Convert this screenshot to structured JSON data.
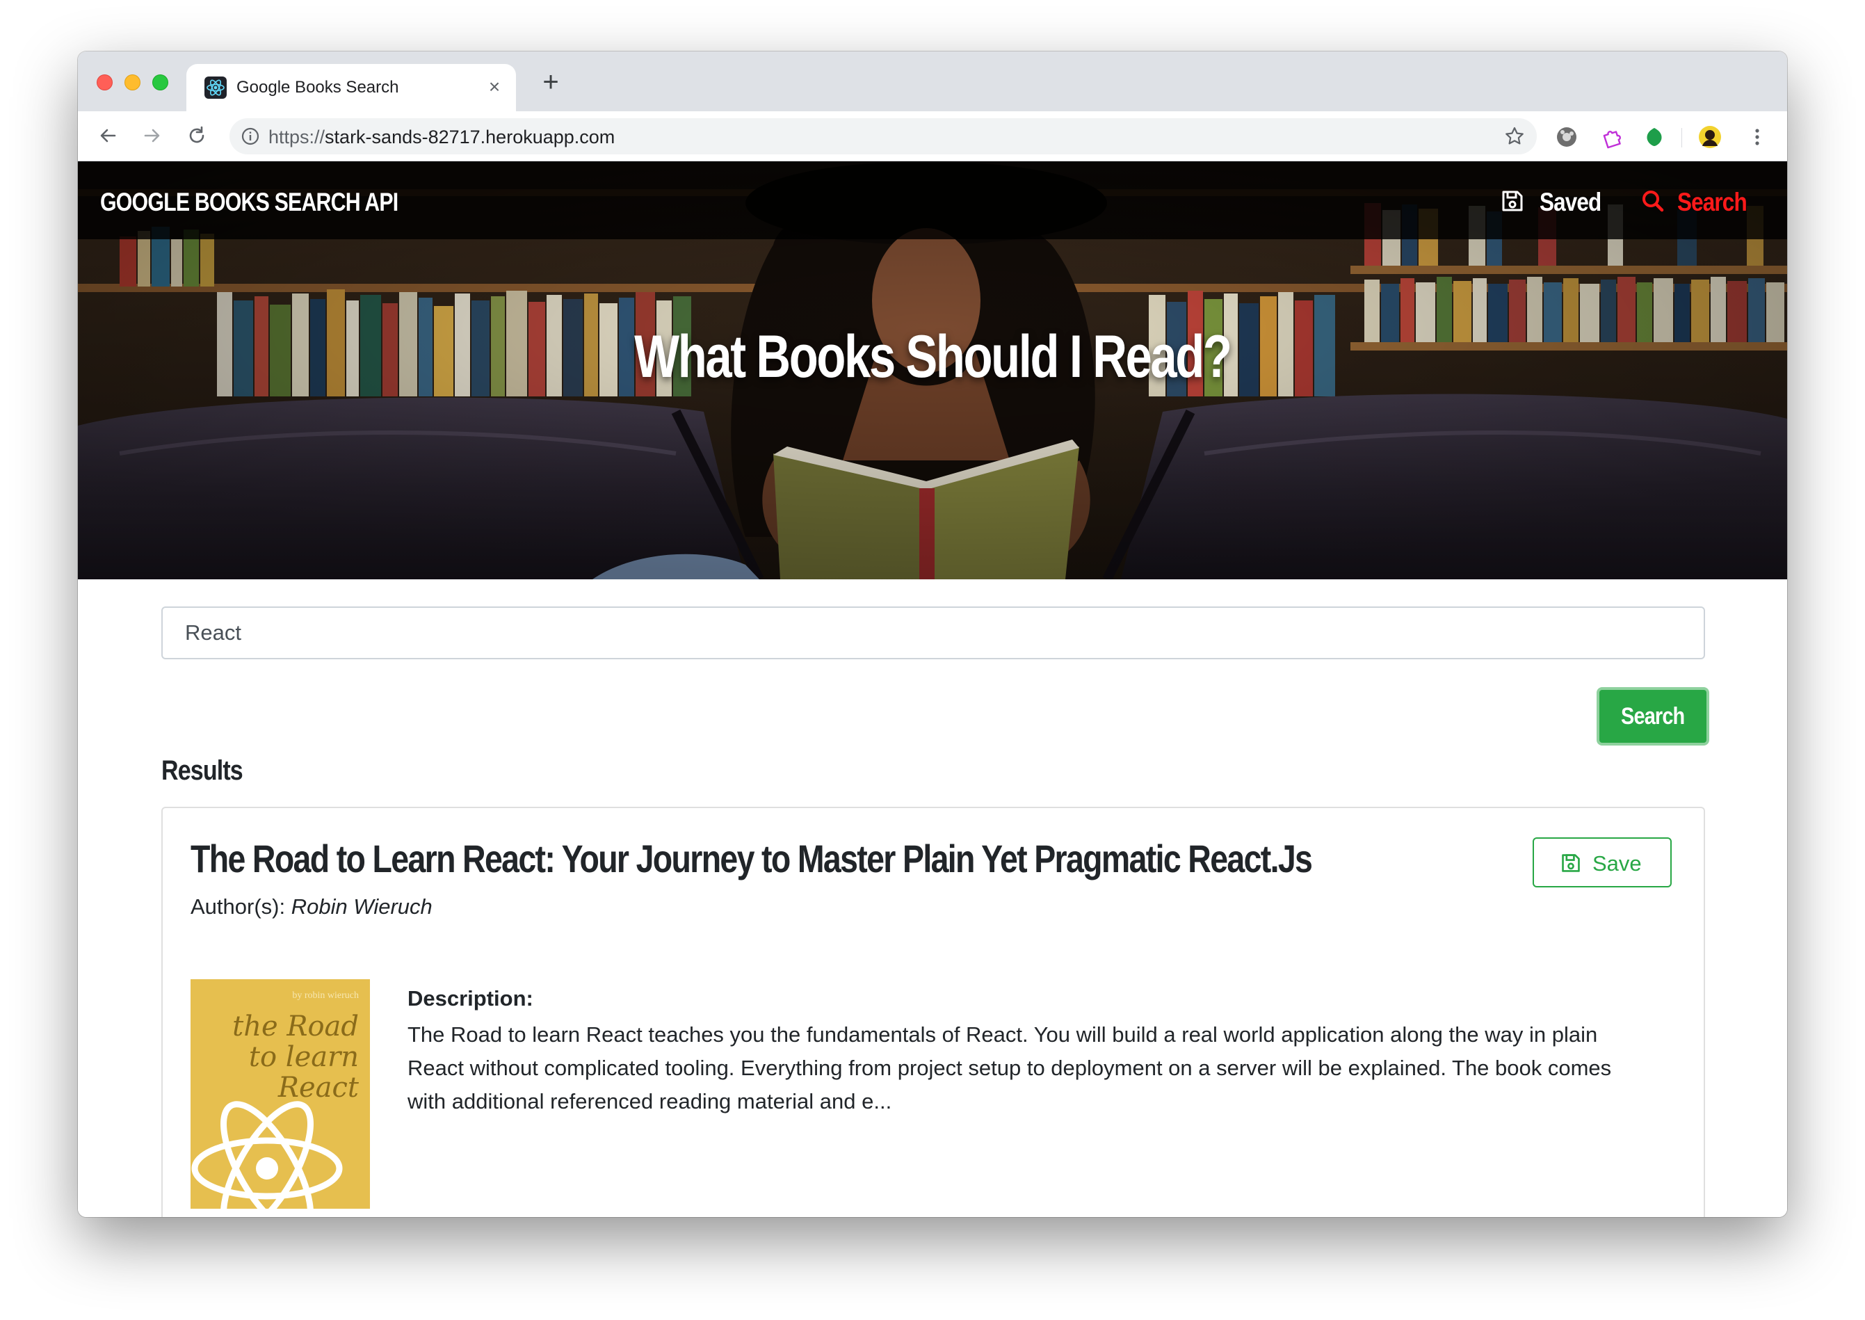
{
  "browser": {
    "tab_title": "Google Books Search",
    "url_scheme": "https://",
    "url_host": "stark-sands-82717.herokuapp.com"
  },
  "navbar": {
    "brand": "GOOGLE BOOKS SEARCH API",
    "saved_label": "Saved",
    "search_label": "Search",
    "active_color": "#ff1a1a"
  },
  "hero": {
    "title": "What Books Should I Read?"
  },
  "search": {
    "value": "React",
    "button_label": "Search",
    "button_color": "#28a745"
  },
  "results": {
    "heading": "Results",
    "items": [
      {
        "title": "The Road to Learn React: Your Journey to Master Plain Yet Pragmatic React.Js",
        "authors_label": "Author(s): ",
        "authors": "Robin Wieruch",
        "save_label": "Save",
        "description_label": "Description:",
        "description": "The Road to learn React teaches you the fundamentals of React. You will build a real world application along the way in plain React without complicated tooling. Everything from project setup to deployment on a server will be explained. The book comes with additional referenced reading material and e...",
        "cover": {
          "byline": "by robin wieruch",
          "title": "the Road to learn React",
          "color": "#e6bf4f"
        }
      }
    ]
  }
}
